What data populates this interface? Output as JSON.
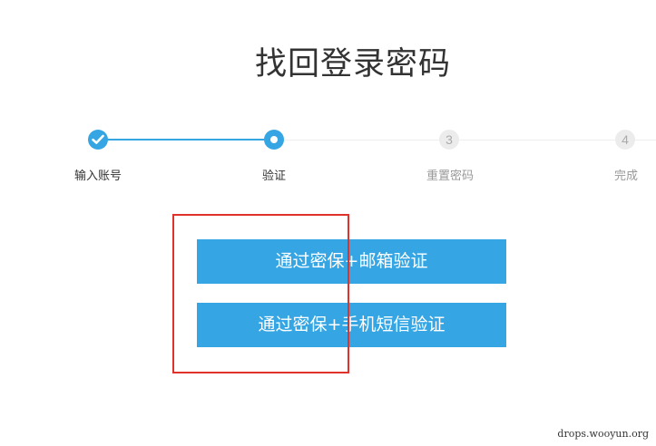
{
  "page": {
    "title": "找回登录密码"
  },
  "steps": {
    "items": [
      {
        "label": "输入账号",
        "state": "done"
      },
      {
        "label": "验证",
        "state": "active"
      },
      {
        "label": "重置密码",
        "state": "pending",
        "number": "3"
      },
      {
        "label": "完成",
        "state": "pending",
        "number": "4"
      }
    ]
  },
  "options": {
    "email": "通过密保+邮箱验证",
    "sms": "通过密保+手机短信验证"
  },
  "watermark": {
    "text": "drops.wooyun.org"
  },
  "colors": {
    "accent": "#35a6e3",
    "highlight": "#e0322c",
    "pending": "#ececec"
  },
  "icons": {
    "done": "checkmark-icon",
    "active": "dot-icon"
  }
}
